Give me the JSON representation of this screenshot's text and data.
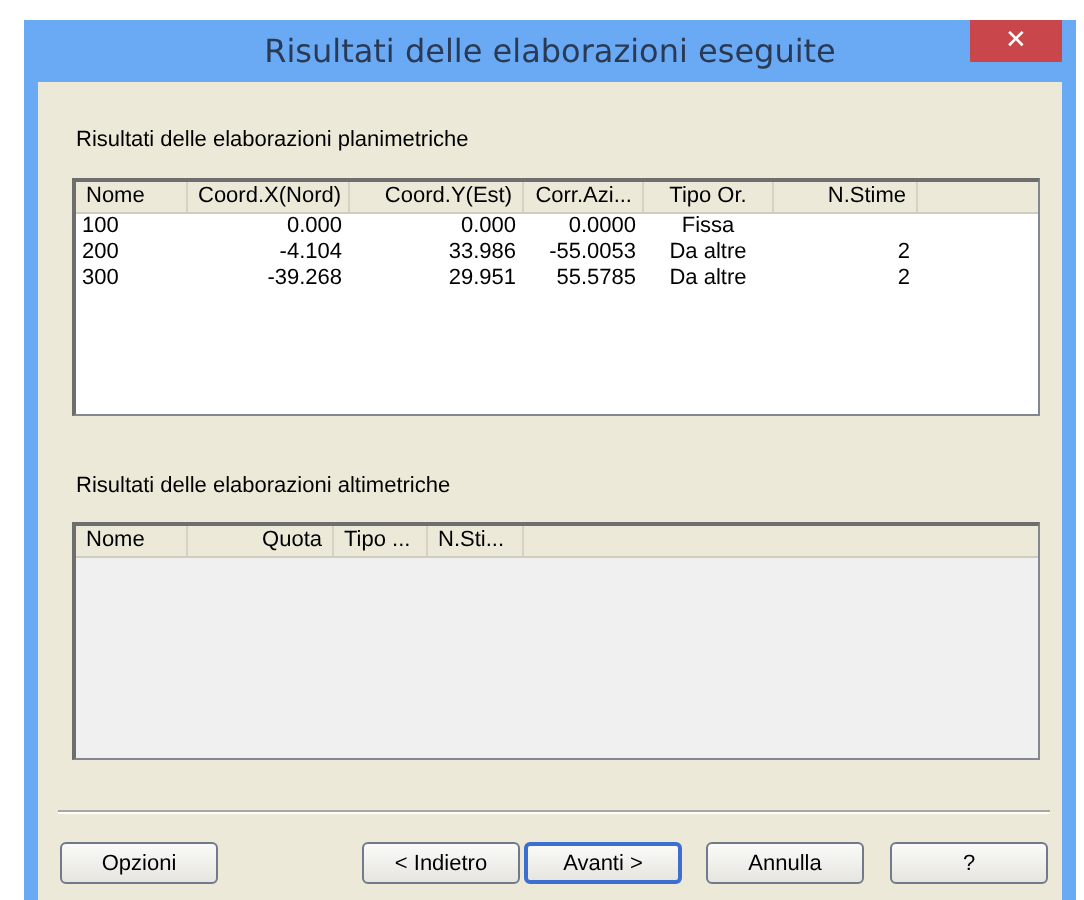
{
  "window": {
    "title": "Risultati delle elaborazioni eseguite",
    "close": "✕"
  },
  "planimetric": {
    "label": "Risultati delle elaborazioni planimetriche",
    "columns": [
      "Nome",
      "Coord.X(Nord)",
      "Coord.Y(Est)",
      "Corr.Azi...",
      "Tipo Or.",
      "N.Stime"
    ],
    "rows": [
      [
        "100",
        "0.000",
        "0.000",
        "0.0000",
        "Fissa",
        ""
      ],
      [
        "200",
        "-4.104",
        "33.986",
        "-55.0053",
        "Da altre",
        "2"
      ],
      [
        "300",
        "-39.268",
        "29.951",
        "55.5785",
        "Da altre",
        "2"
      ]
    ]
  },
  "altimetric": {
    "label": "Risultati delle elaborazioni altimetriche",
    "columns": [
      "Nome",
      "Quota",
      "Tipo ...",
      "N.Sti..."
    ]
  },
  "buttons": [
    {
      "label": "Opzioni",
      "default": false
    },
    {
      "label": "< Indietro",
      "default": false
    },
    {
      "label": "Avanti >",
      "default": true
    },
    {
      "label": "Annulla",
      "default": false
    },
    {
      "label": "?",
      "default": false
    }
  ]
}
